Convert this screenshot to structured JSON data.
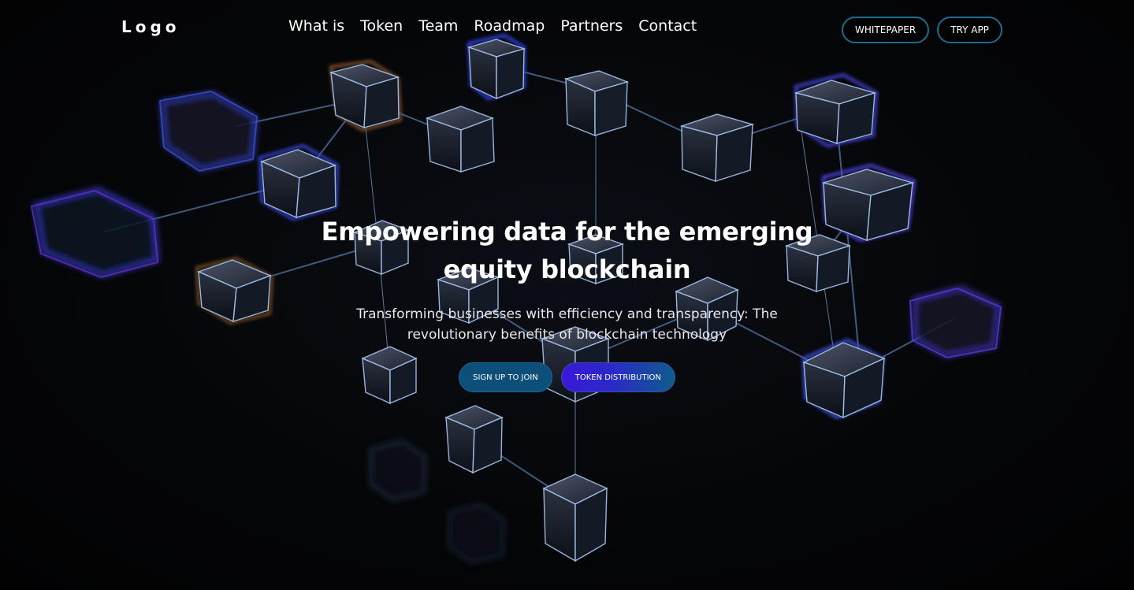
{
  "header": {
    "logo": "Logo",
    "nav": [
      "What is",
      "Token",
      "Team",
      "Roadmap",
      "Partners",
      "Contact"
    ],
    "whitepaper_label": "WHITEPAPER",
    "try_app_label": "TRY APP"
  },
  "hero": {
    "title": "Empowering data for the emerging equity blockchain",
    "subtitle": "Transforming businesses with efficiency and transparency: The revolutionary benefits of blockchain technology",
    "signup_label": "SIGN UP TO JOIN",
    "token_label": "TOKEN DISTRIBUTION"
  },
  "colors": {
    "background": "#050505",
    "accent_blue": "#0e4f7a",
    "accent_purple": "#3a18d8",
    "outline": "#1f6b8e"
  },
  "icons": {
    "background_graphic": "blockchain-network-cubes"
  }
}
